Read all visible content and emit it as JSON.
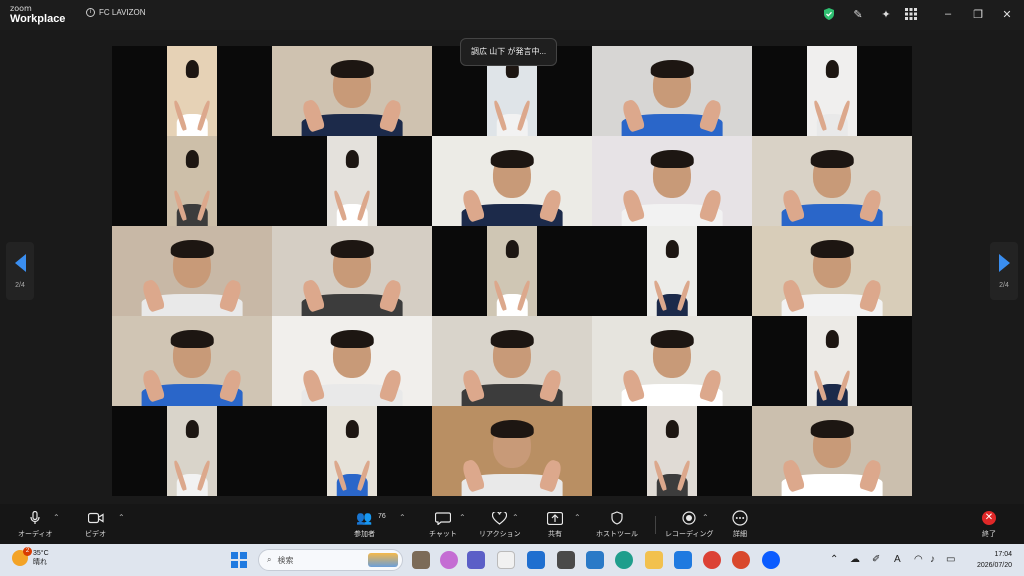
{
  "window": {
    "brand_small": "zoom",
    "brand_large": "Workplace",
    "meeting_name": "FC LAVIZON"
  },
  "speaking_indicator": "調広 山下 が発言中...",
  "pager": {
    "left_label": "2/4",
    "right_label": "2/4"
  },
  "controls": {
    "audio": "オーディオ",
    "video": "ビデオ",
    "participants_count": "76",
    "participants": "参加者",
    "chat": "チャット",
    "reactions": "リアクション",
    "share": "共有",
    "host_tools": "ホストツール",
    "record": "レコーディング",
    "more": "詳細",
    "end": "終了"
  },
  "taskbar": {
    "weather_badge": "2",
    "temperature": "35°C",
    "condition": "晴れ",
    "search_placeholder": "検索",
    "time": "17:04",
    "date": "2026/07/20",
    "colors": {
      "accent": "#1f7ae0",
      "end_red": "#e02828",
      "pager_blue": "#3a8ef0"
    }
  }
}
